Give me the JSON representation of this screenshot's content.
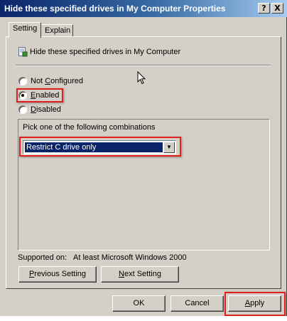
{
  "window": {
    "title": "Hide these specified drives in My Computer Properties",
    "help_button": "?",
    "close_button": "X"
  },
  "tabs": [
    {
      "label": "Setting",
      "active": true
    },
    {
      "label": "Explain",
      "active": false
    }
  ],
  "policy": {
    "icon": "policy-setting-icon",
    "title": "Hide these specified drives in My Computer"
  },
  "options": {
    "not_configured": {
      "pre": "Not ",
      "key": "C",
      "post": "onfigured",
      "selected": false
    },
    "enabled": {
      "pre": "",
      "key": "E",
      "post": "nabled",
      "selected": true
    },
    "disabled": {
      "pre": "",
      "key": "D",
      "post": "isabled",
      "selected": false
    }
  },
  "combinations": {
    "label": "Pick one of the following combinations",
    "selected": "Restrict C drive only"
  },
  "supported": {
    "label": "Supported on:",
    "value": "At least Microsoft Windows 2000"
  },
  "nav": {
    "previous": {
      "key": "P",
      "post": "revious Setting"
    },
    "next": {
      "key": "N",
      "post": "ext Setting"
    }
  },
  "buttons": {
    "ok": "OK",
    "cancel": "Cancel",
    "apply": {
      "key": "A",
      "post": "pply"
    }
  },
  "colors": {
    "highlight_red": "#e0201e",
    "titlebar_blue": "#0a246a",
    "dialog_gray": "#d4d0c8"
  }
}
